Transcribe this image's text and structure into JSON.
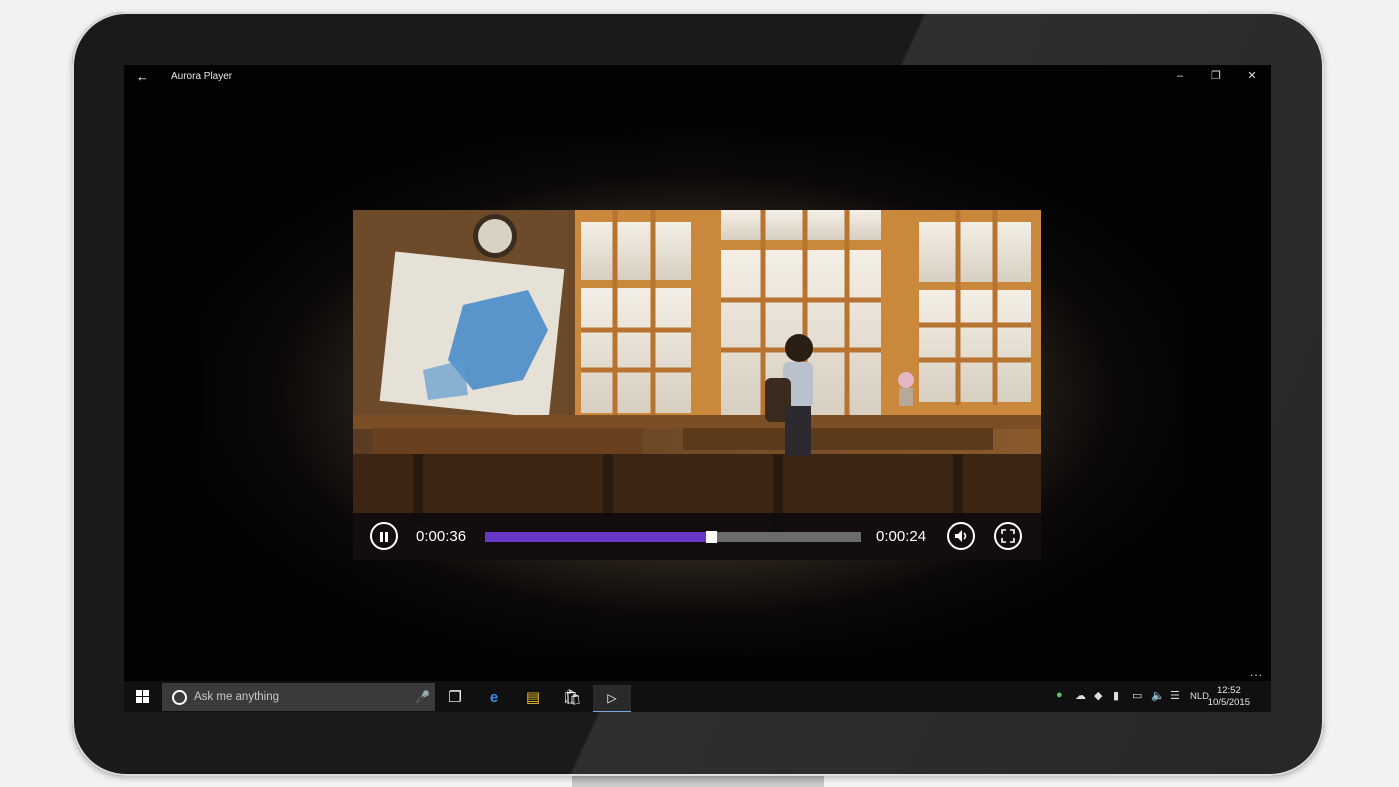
{
  "window": {
    "title": "Aurora Player",
    "back_icon": "back-arrow-icon",
    "minimize_icon": "minimize-icon",
    "restore_icon": "restore-icon",
    "close_icon": "close-icon"
  },
  "player": {
    "elapsed": "0:00:36",
    "remaining": "0:00:24",
    "progress": 0.6,
    "progress_color": "#6a38c8",
    "play_state": "playing",
    "video_description": "boy seated at desk in sunlit classroom by large windows"
  },
  "app_bar": {
    "more_label": "..."
  },
  "taskbar": {
    "search_placeholder": "Ask me anything",
    "pinned": [
      "task-view-icon",
      "edge-icon",
      "file-explorer-icon",
      "store-icon",
      "aurora-player-icon"
    ],
    "tray_icons": [
      "network-icon",
      "onedrive-icon",
      "dropbox-icon",
      "battery-icon",
      "display-icon",
      "volume-icon",
      "action-center-icon"
    ],
    "language": "NLD",
    "time": "12:52",
    "date": "10/5/2015"
  }
}
